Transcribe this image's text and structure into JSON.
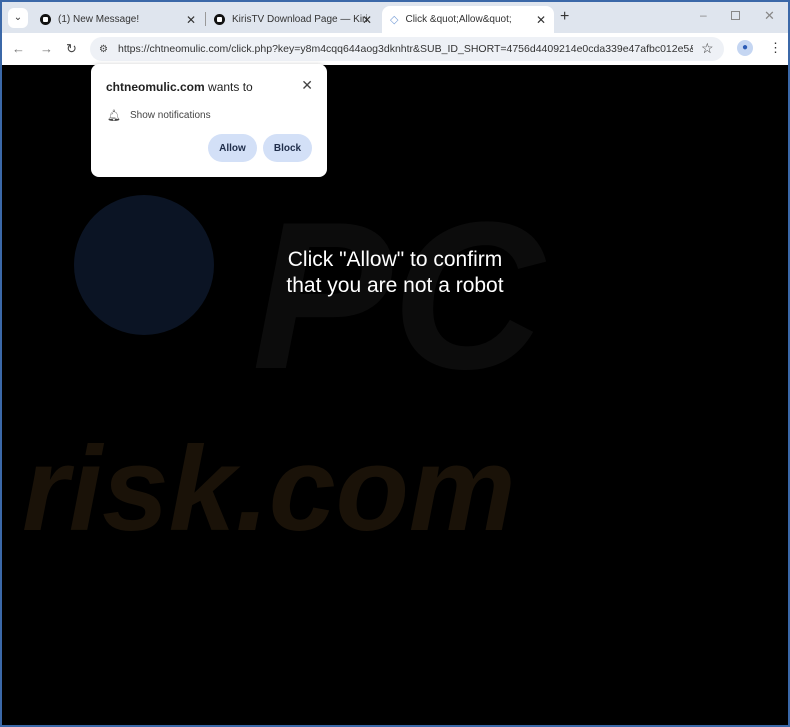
{
  "tabs": [
    {
      "title": "(1) New Message!",
      "icon": "site-icon"
    },
    {
      "title": "KirisTV Download Page — Kiris",
      "icon": "site-icon"
    },
    {
      "title": "Click &quot;Allow&quot;",
      "icon": "loading-icon",
      "active": true
    }
  ],
  "address": {
    "url": "https://chtneomulic.com/click.php?key=y8m4cqq644aog3dknhtr&SUB_ID_SHORT=4756d4409214e0cda339e47afbc012e5&P..."
  },
  "popup": {
    "site": "chtneomulic.com",
    "wants": " wants to",
    "permission": "Show notifications",
    "allow": "Allow",
    "block": "Block"
  },
  "page": {
    "line1": "Click \"Allow\" to confirm",
    "line2": "that you are not a robot"
  },
  "watermark": {
    "text1": "PC",
    "text2": "risk.com"
  },
  "colors": {
    "border": "#3b68a8",
    "button": "#d3e0f7"
  }
}
